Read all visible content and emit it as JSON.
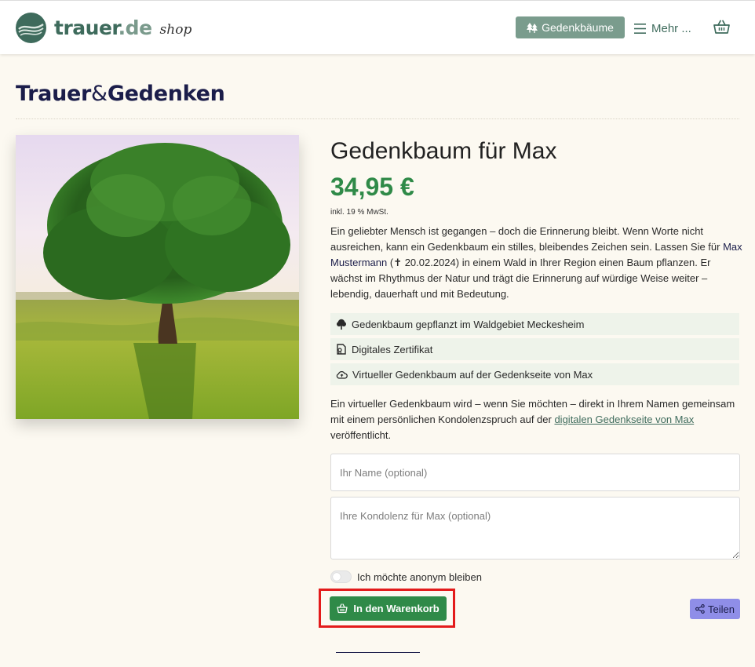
{
  "header": {
    "logo_word": "trauer",
    "logo_tld": ".de",
    "logo_shop": "shop",
    "gedenkbaeume_label": "Gedenkbäume",
    "more_label": "Mehr ...",
    "icons": {
      "trees": "trees-icon",
      "menu": "hamburger-menu-icon",
      "cart": "basket-icon"
    }
  },
  "brand": {
    "part1": "Trauer",
    "amp": "&",
    "part2": "Gedenken"
  },
  "product": {
    "image": "tree-in-meadow-photo",
    "title": "Gedenkbaum für Max",
    "price": "34,95 €",
    "tax_note": "inkl. 19 % MwSt.",
    "description_1": "Ein geliebter Mensch ist gegangen – doch die Erinnerung bleibt. Wenn Worte nicht ausreichen, kann ein Gedenkbaum ein stilles, bleibendes Zeichen sein. Lassen Sie für ",
    "description_name": "Max Mustermann",
    "description_2": " (✝ 20.02.2024) in einem Wald in Ihrer Region einen Baum pflanzen. Er wächst im Rhythmus der Natur und trägt die Erinnerung auf würdige Weise weiter – lebendig, dauerhaft und mit Bedeutung."
  },
  "features": [
    {
      "icon": "tree-icon",
      "label": "Gedenkbaum gepflanzt im Waldgebiet Meckesheim"
    },
    {
      "icon": "certificate-icon",
      "label": "Digitales Zertifikat"
    },
    {
      "icon": "cloud-icon",
      "label": "Virtueller Gedenkbaum auf der Gedenkseite von Max"
    }
  ],
  "info": {
    "text_1": "Ein virtueller Gedenkbaum wird – wenn Sie möchten – direkt in Ihrem Namen gemeinsam mit einem persönlichen Kondolenzspruch auf der ",
    "link": "digitalen Gedenkseite von Max",
    "text_2": " veröffentlicht."
  },
  "form": {
    "name_placeholder": "Ihr Name (optional)",
    "kondolenz_placeholder": "Ihre Kondolenz für Max (optional)",
    "anonymous_label": "Ich möchte anonym bleiben",
    "anonymous_checked": false
  },
  "actions": {
    "cart_label": "In den Warenkorb",
    "share_label": "Teilen"
  },
  "colors": {
    "brand_green": "#3e6b5c",
    "price_green": "#2f8a48",
    "highlight_red": "#e31b1b",
    "share_purple": "#8f8ee8",
    "navy": "#1b1d4a"
  }
}
